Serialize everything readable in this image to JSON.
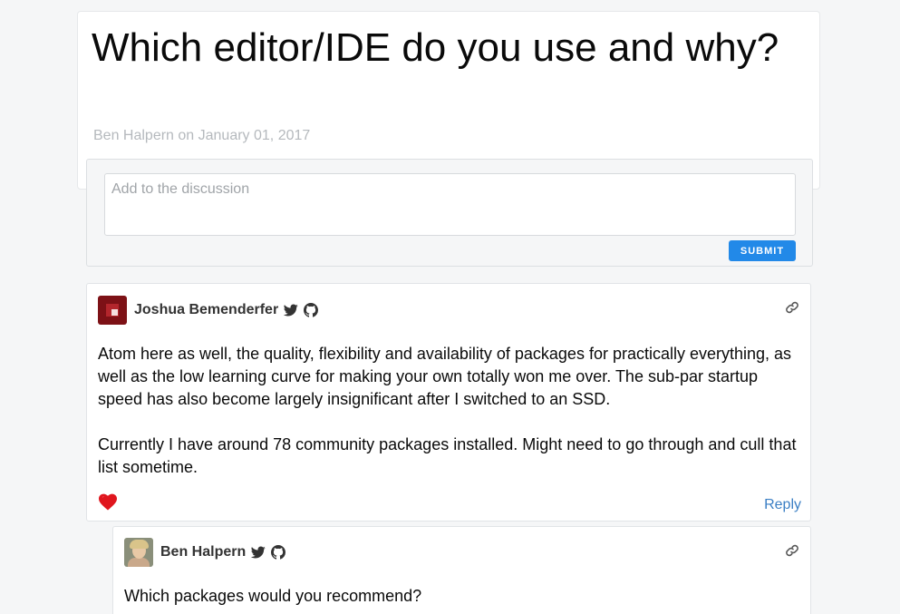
{
  "article": {
    "title": "Which editor/IDE do you use and why?",
    "meta": "Ben Halpern on January 01, 2017"
  },
  "discussion": {
    "placeholder": "Add to the discussion",
    "submit_label": "SUBMIT"
  },
  "comments": [
    {
      "author": "Joshua Bemenderfer",
      "icons": [
        "twitter-icon",
        "github-icon",
        "link-icon"
      ],
      "paragraphs": [
        "Atom here as well, the quality, flexibility and availability of packages for practically everything, as well as the low learning curve for making your own totally won me over. The sub-par startup speed has also become largely insignificant after I switched to an SSD.",
        "Currently I have around 78 community packages installed. Might need to go through and cull that list sometime."
      ],
      "reaction_icon": "heart-icon",
      "reply_label": "Reply"
    },
    {
      "author": "Ben Halpern",
      "icons": [
        "twitter-icon",
        "github-icon",
        "link-icon"
      ],
      "paragraphs": [
        "Which packages would you recommend?"
      ]
    }
  ],
  "colors": {
    "accent": "#2289e8",
    "link": "#3b7fc4",
    "muted_text": "#b5b9bd",
    "heart": "#e0161e"
  }
}
